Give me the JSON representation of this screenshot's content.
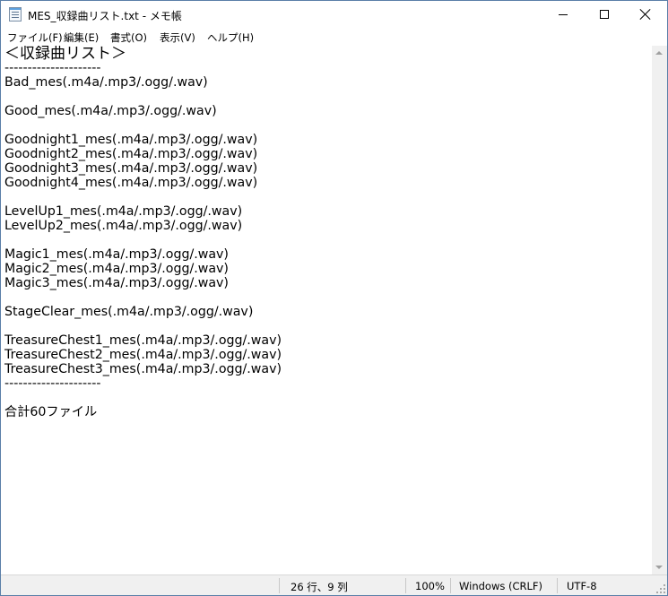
{
  "window": {
    "title": "MES_収録曲リスト.txt - メモ帳"
  },
  "menu": {
    "items": [
      "ファイル(F)",
      "編集(E)",
      "書式(O)",
      "表示(V)",
      "ヘルプ(H)"
    ]
  },
  "editor": {
    "lines": [
      "＜収録曲リスト＞",
      "---------------------",
      "Bad_mes(.m4a/.mp3/.ogg/.wav)",
      "",
      "Good_mes(.m4a/.mp3/.ogg/.wav)",
      "",
      "Goodnight1_mes(.m4a/.mp3/.ogg/.wav)",
      "Goodnight2_mes(.m4a/.mp3/.ogg/.wav)",
      "Goodnight3_mes(.m4a/.mp3/.ogg/.wav)",
      "Goodnight4_mes(.m4a/.mp3/.ogg/.wav)",
      "",
      "LevelUp1_mes(.m4a/.mp3/.ogg/.wav)",
      "LevelUp2_mes(.m4a/.mp3/.ogg/.wav)",
      "",
      "Magic1_mes(.m4a/.mp3/.ogg/.wav)",
      "Magic2_mes(.m4a/.mp3/.ogg/.wav)",
      "Magic3_mes(.m4a/.mp3/.ogg/.wav)",
      "",
      "StageClear_mes(.m4a/.mp3/.ogg/.wav)",
      "",
      "TreasureChest1_mes(.m4a/.mp3/.ogg/.wav)",
      "TreasureChest2_mes(.m4a/.mp3/.ogg/.wav)",
      "TreasureChest3_mes(.m4a/.mp3/.ogg/.wav)",
      "---------------------",
      "",
      "合計60ファイル"
    ]
  },
  "status": {
    "position": "26 行、9 列",
    "zoom": "100%",
    "line_ending": "Windows (CRLF)",
    "encoding": "UTF-8"
  },
  "icons": {
    "app": "notepad-icon",
    "minimize": "minimize-icon",
    "maximize": "maximize-icon",
    "close": "close-icon"
  }
}
